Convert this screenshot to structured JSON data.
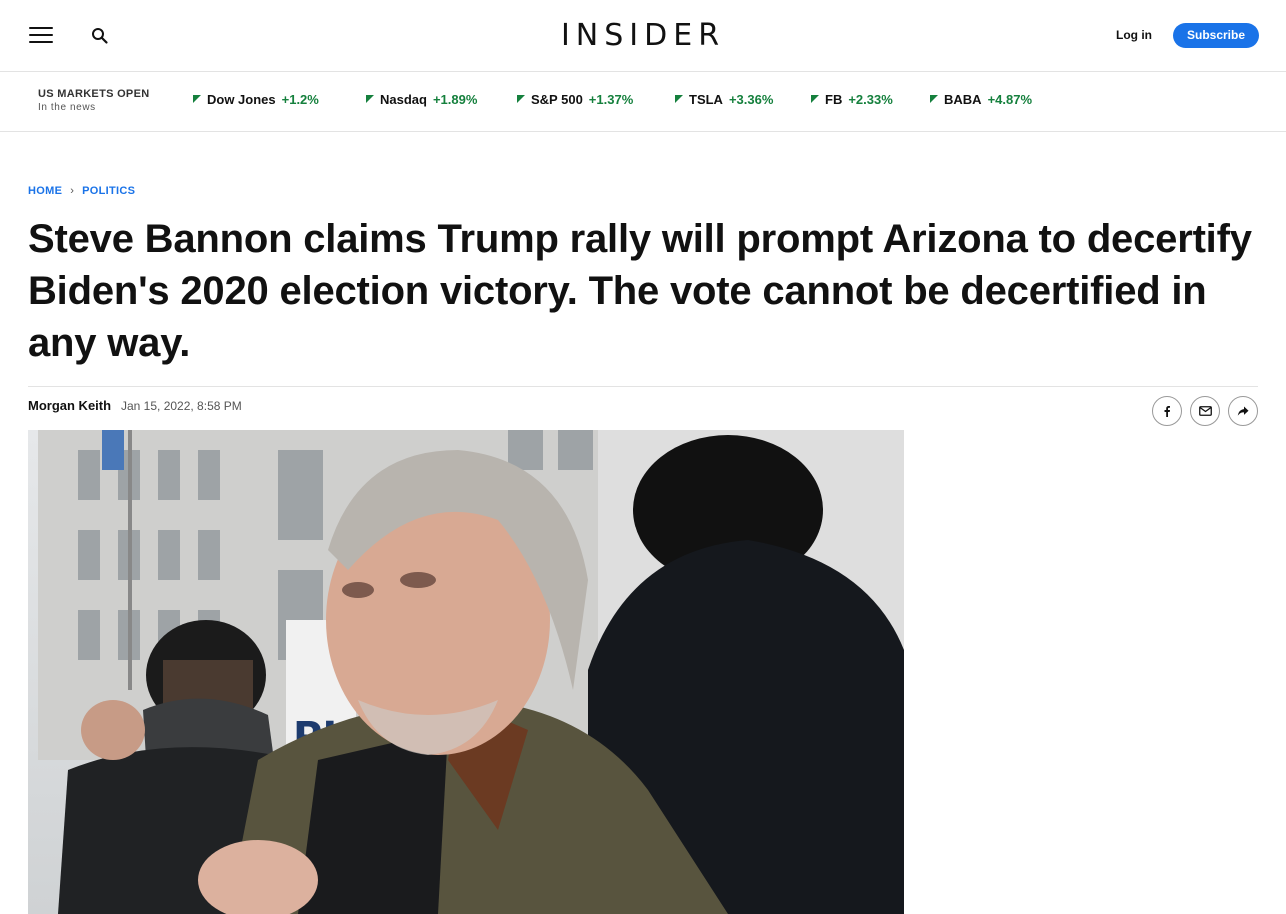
{
  "header": {
    "logo": "INSIDER",
    "login_label": "Log in",
    "subscribe_label": "Subscribe",
    "menu_icon": "hamburger-menu-icon",
    "search_icon": "search-icon",
    "accent_color": "#1a73e8"
  },
  "markets": {
    "title": "US MARKETS OPEN",
    "subtitle": "In the news",
    "tickers": [
      {
        "name": "Dow Jones",
        "change": "+1.2%"
      },
      {
        "name": "Nasdaq",
        "change": "+1.89%"
      },
      {
        "name": "S&P 500",
        "change": "+1.37%"
      },
      {
        "name": "TSLA",
        "change": "+3.36%"
      },
      {
        "name": "FB",
        "change": "+2.33%"
      },
      {
        "name": "BABA",
        "change": "+4.87%"
      }
    ],
    "up_color": "#15803d"
  },
  "article": {
    "breadcrumb": [
      "HOME",
      "POLITICS"
    ],
    "headline": "Steve Bannon claims Trump rally will prompt Arizona to decertify Biden's 2020 election victory. The vote cannot be decertified in any way.",
    "author": "Morgan Keith",
    "date": "Jan 15, 2022, 8:58 PM",
    "share_icons": [
      "facebook-icon",
      "email-icon",
      "share-icon"
    ]
  }
}
